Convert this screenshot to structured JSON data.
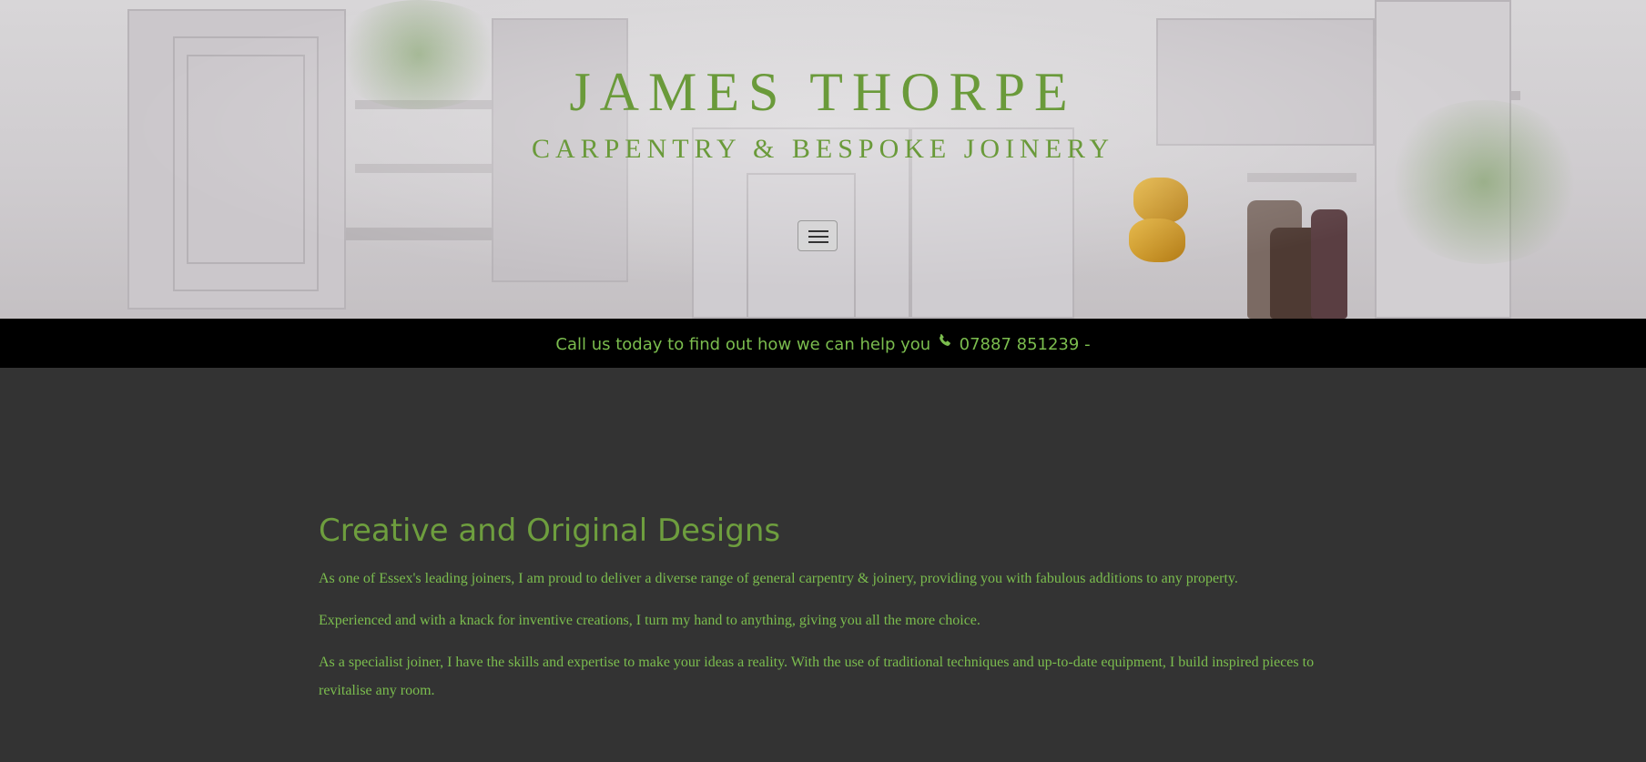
{
  "header": {
    "logo_title": "JAMES THORPE",
    "logo_subtitle": "CARPENTRY & BESPOKE JOINERY",
    "menu_icon": "hamburger-icon"
  },
  "callbar": {
    "text": "Call us today to find out how we can help you",
    "phone_icon": "phone-icon",
    "phone": "07887 851239",
    "trailing": "-"
  },
  "main": {
    "heading": "Creative and Original Designs",
    "paragraphs": [
      "As one of Essex's leading joiners, I am proud to deliver a diverse range of general carpentry & joinery, providing you with fabulous additions to any property.",
      "Experienced and with a knack for inventive creations, I turn my hand to anything, giving you all the more choice.",
      "As a specialist joiner, I have the skills and expertise to make your ideas a reality. With the use of traditional techniques and up-to-date equipment, I build inspired pieces to revitalise any room."
    ]
  },
  "colors": {
    "brand_green": "#6a9a3a",
    "text_green": "#7bbd4e",
    "page_bg": "#333333",
    "bar_bg": "#000000"
  }
}
